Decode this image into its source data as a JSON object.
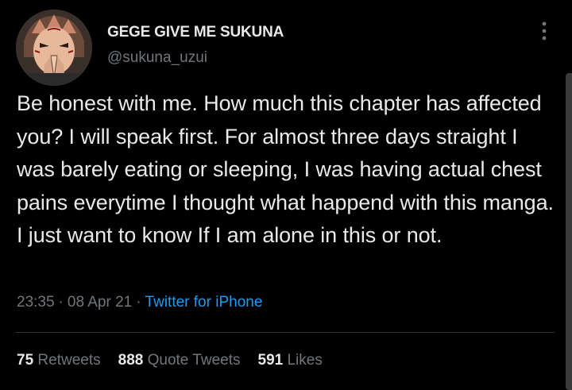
{
  "author": {
    "display_name": "GEGE GIVE ME SUKUNA",
    "handle": "@sukuna_uzui",
    "avatar_icon": "anime-character-avatar"
  },
  "tweet": {
    "text": "Be honest with me. How much this chapter has affected you? I will speak first. For almost three days straight I was barely eating or sleeping, I was having actual chest pains everytime I thought what happend with this manga. I just want to know If I am alone in this or not.",
    "time": "23:35",
    "date": "08 Apr 21",
    "separator": "·",
    "source": "Twitter for iPhone"
  },
  "stats": {
    "retweets_count": "75",
    "retweets_label": "Retweets",
    "quote_tweets_count": "888",
    "quote_tweets_label": "Quote Tweets",
    "likes_count": "591",
    "likes_label": "Likes"
  },
  "colors": {
    "background": "#000000",
    "primary_text": "#e7e9ea",
    "secondary_text": "#71767b",
    "link": "#1d9bf0"
  }
}
